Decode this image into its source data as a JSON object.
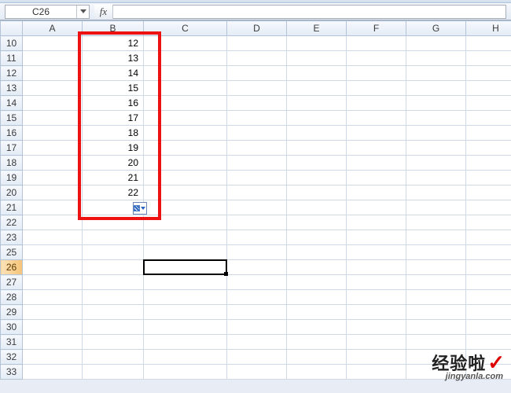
{
  "namebox": {
    "value": "C26"
  },
  "formula_bar": {
    "fx_label": "fx",
    "value": ""
  },
  "columns": [
    "A",
    "B",
    "C",
    "D",
    "E",
    "F",
    "G",
    "H"
  ],
  "row_start": 10,
  "row_end": 33,
  "hidden_rows": [
    24
  ],
  "active_cell": {
    "col": "C",
    "row": 26
  },
  "highlighted_column": "C",
  "highlighted_row": 26,
  "cells": {
    "B10": "12",
    "B11": "13",
    "B12": "14",
    "B13": "15",
    "B14": "16",
    "B15": "17",
    "B16": "18",
    "B17": "19",
    "B18": "20",
    "B19": "21",
    "B20": "22"
  },
  "red_annotation_range": {
    "top_row": 10,
    "bottom_row": 21,
    "col": "B"
  },
  "autofill_button_at": {
    "col": "B",
    "row": 21,
    "corner": "br"
  },
  "watermark": {
    "brand_cn": "经验啦",
    "url": "jingyanla.com"
  },
  "chart_data": {
    "type": "table",
    "columns": [
      "B"
    ],
    "rows": [
      10,
      11,
      12,
      13,
      14,
      15,
      16,
      17,
      18,
      19,
      20
    ],
    "values": [
      12,
      13,
      14,
      15,
      16,
      17,
      18,
      19,
      20,
      21,
      22
    ]
  }
}
